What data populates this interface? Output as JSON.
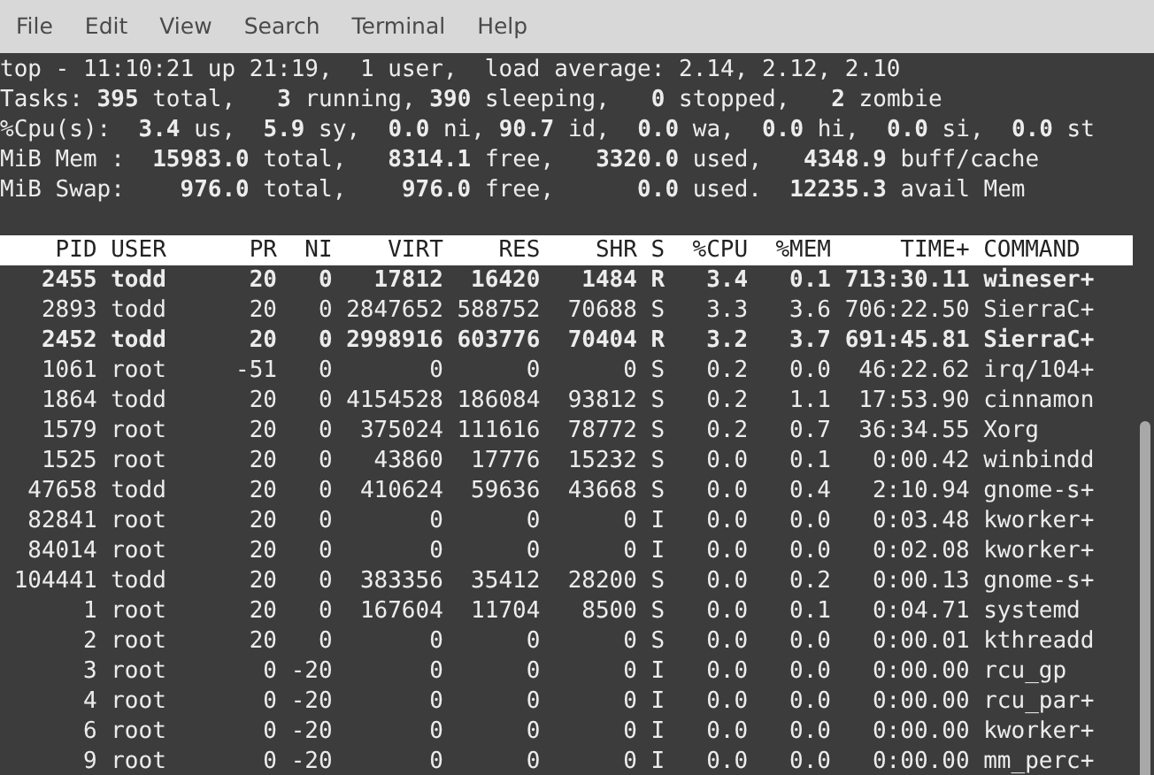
{
  "menu": [
    "File",
    "Edit",
    "View",
    "Search",
    "Terminal",
    "Help"
  ],
  "summary": [
    "top - 11:10:21 up 21:19,  1 user,  load average: 2.14, 2.12, 2.10",
    "Tasks: **395** total,   **3** running, **390** sleeping,   **0** stopped,   **2** zombie",
    "%Cpu(s):  **3.4** us,  **5.9** sy,  **0.0** ni, **90.7** id,  **0.0** wa,  **0.0** hi,  **0.0** si,  **0.0** st",
    "MiB Mem :  **15983.0** total,   **8314.1** free,   **3320.0** used,   **4348.9** buff/cache",
    "MiB Swap:    **976.0** total,    **976.0** free,      **0.0** used.  **12235.3** avail Mem"
  ],
  "columns": [
    "PID",
    "USER",
    "PR",
    "NI",
    "VIRT",
    "RES",
    "SHR",
    "S",
    "%CPU",
    "%MEM",
    "TIME+",
    "COMMAND"
  ],
  "rows": [
    {
      "highlighted": true,
      "cells": [
        "2455",
        "todd",
        "20",
        "0",
        "17812",
        "16420",
        "1484",
        "R",
        "3.4",
        "0.1",
        "713:30.11",
        "wineser+"
      ]
    },
    {
      "highlighted": false,
      "cells": [
        "2893",
        "todd",
        "20",
        "0",
        "2847652",
        "588752",
        "70688",
        "S",
        "3.3",
        "3.6",
        "706:22.50",
        "SierraC+"
      ]
    },
    {
      "highlighted": true,
      "cells": [
        "2452",
        "todd",
        "20",
        "0",
        "2998916",
        "603776",
        "70404",
        "R",
        "3.2",
        "3.7",
        "691:45.81",
        "SierraC+"
      ]
    },
    {
      "highlighted": false,
      "cells": [
        "1061",
        "root",
        "-51",
        "0",
        "0",
        "0",
        "0",
        "S",
        "0.2",
        "0.0",
        "46:22.62",
        "irq/104+"
      ]
    },
    {
      "highlighted": false,
      "cells": [
        "1864",
        "todd",
        "20",
        "0",
        "4154528",
        "186084",
        "93812",
        "S",
        "0.2",
        "1.1",
        "17:53.90",
        "cinnamon"
      ]
    },
    {
      "highlighted": false,
      "cells": [
        "1579",
        "root",
        "20",
        "0",
        "375024",
        "111616",
        "78772",
        "S",
        "0.2",
        "0.7",
        "36:34.55",
        "Xorg"
      ]
    },
    {
      "highlighted": false,
      "cells": [
        "1525",
        "root",
        "20",
        "0",
        "43860",
        "17776",
        "15232",
        "S",
        "0.0",
        "0.1",
        "0:00.42",
        "winbindd"
      ]
    },
    {
      "highlighted": false,
      "cells": [
        "47658",
        "todd",
        "20",
        "0",
        "410624",
        "59636",
        "43668",
        "S",
        "0.0",
        "0.4",
        "2:10.94",
        "gnome-s+"
      ]
    },
    {
      "highlighted": false,
      "cells": [
        "82841",
        "root",
        "20",
        "0",
        "0",
        "0",
        "0",
        "I",
        "0.0",
        "0.0",
        "0:03.48",
        "kworker+"
      ]
    },
    {
      "highlighted": false,
      "cells": [
        "84014",
        "root",
        "20",
        "0",
        "0",
        "0",
        "0",
        "I",
        "0.0",
        "0.0",
        "0:02.08",
        "kworker+"
      ]
    },
    {
      "highlighted": false,
      "cells": [
        "104441",
        "todd",
        "20",
        "0",
        "383356",
        "35412",
        "28200",
        "S",
        "0.0",
        "0.2",
        "0:00.13",
        "gnome-s+"
      ]
    },
    {
      "highlighted": false,
      "cells": [
        "1",
        "root",
        "20",
        "0",
        "167604",
        "11704",
        "8500",
        "S",
        "0.0",
        "0.1",
        "0:04.71",
        "systemd"
      ]
    },
    {
      "highlighted": false,
      "cells": [
        "2",
        "root",
        "20",
        "0",
        "0",
        "0",
        "0",
        "S",
        "0.0",
        "0.0",
        "0:00.01",
        "kthreadd"
      ]
    },
    {
      "highlighted": false,
      "cells": [
        "3",
        "root",
        "0",
        "-20",
        "0",
        "0",
        "0",
        "I",
        "0.0",
        "0.0",
        "0:00.00",
        "rcu_gp"
      ]
    },
    {
      "highlighted": false,
      "cells": [
        "4",
        "root",
        "0",
        "-20",
        "0",
        "0",
        "0",
        "I",
        "0.0",
        "0.0",
        "0:00.00",
        "rcu_par+"
      ]
    },
    {
      "highlighted": false,
      "cells": [
        "6",
        "root",
        "0",
        "-20",
        "0",
        "0",
        "0",
        "I",
        "0.0",
        "0.0",
        "0:00.00",
        "kworker+"
      ]
    },
    {
      "highlighted": false,
      "cells": [
        "9",
        "root",
        "0",
        "-20",
        "0",
        "0",
        "0",
        "I",
        "0.0",
        "0.0",
        "0:00.00",
        "mm_perc+"
      ]
    }
  ]
}
